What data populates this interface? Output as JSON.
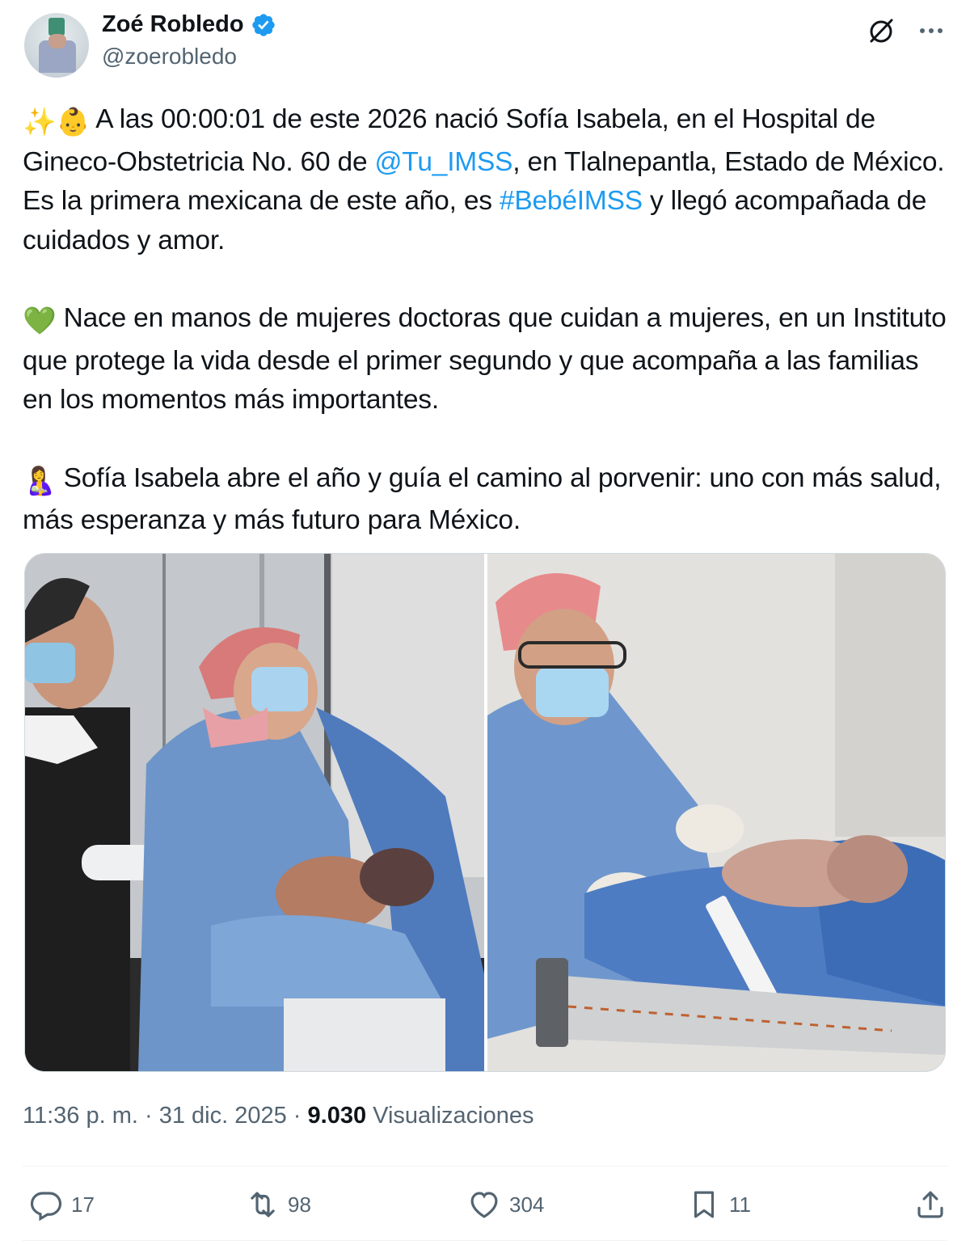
{
  "author": {
    "name": "Zoé Robledo",
    "handle": "@zoerobledo"
  },
  "tweet": {
    "p1": {
      "emoji": "✨👶",
      "t1": " A las 00:00:01 de este 2026 nació Sofía Isabela, en el Hospital de Gineco-Obstetricia No. 60 de ",
      "mention": "@Tu_IMSS",
      "t2": ", en Tlalnepantla, Estado de México. Es la primera mexicana de este año, es ",
      "hashtag": "#BebéIMSS",
      "t3": " y llegó acompañada de cuidados y amor."
    },
    "p2": {
      "emoji": "💚",
      "text": " Nace en manos de mujeres doctoras que cuidan a mujeres, en un Instituto que protege la vida desde el primer segundo y que acompaña a las familias en los momentos más importantes."
    },
    "p3": {
      "emoji": "🤱",
      "text": " Sofía Isabela abre el año y guía el camino al porvenir: uno con más salud, más esperanza y más futuro para México."
    }
  },
  "meta": {
    "time": "11:36 p. m.",
    "sep1": " · ",
    "date": "31 dic. 2025",
    "sep2": " · ",
    "views": "9.030",
    "views_label": " Visualizaciones"
  },
  "actions": {
    "replies": "17",
    "reposts": "98",
    "likes": "304",
    "bookmarks": "11"
  },
  "colors": {
    "link": "#1d9bf0",
    "verified": "#1d9bf0",
    "muted": "#536471"
  }
}
